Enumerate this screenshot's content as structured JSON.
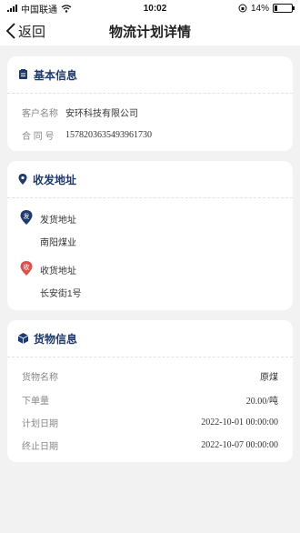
{
  "status": {
    "carrier": "中国联通",
    "time": "10:02",
    "battery": "14%",
    "battery_level": 0.14
  },
  "nav": {
    "back_label": "返回",
    "title": "物流计划详情"
  },
  "basic": {
    "title": "基本信息",
    "customer_label": "客户名称",
    "customer_value": "安环科技有限公司",
    "contract_label": "合 同 号",
    "contract_value": "1578203635493961730"
  },
  "address": {
    "title": "收发地址",
    "ship_icon_char": "发",
    "ship_label": "发货地址",
    "ship_value": "南阳煤业",
    "recv_icon_char": "收",
    "recv_label": "收货地址",
    "recv_value": "长安街1号",
    "colors": {
      "ship": "#1e3a6e",
      "recv": "#d9534f"
    }
  },
  "goods": {
    "title": "货物信息",
    "rows": [
      {
        "label": "货物名称",
        "value": "原煤"
      },
      {
        "label": "下单量",
        "value": "20.00/吨"
      },
      {
        "label": "计划日期",
        "value": "2022-10-01 00:00:00"
      },
      {
        "label": "终止日期",
        "value": "2022-10-07 00:00:00"
      }
    ]
  }
}
